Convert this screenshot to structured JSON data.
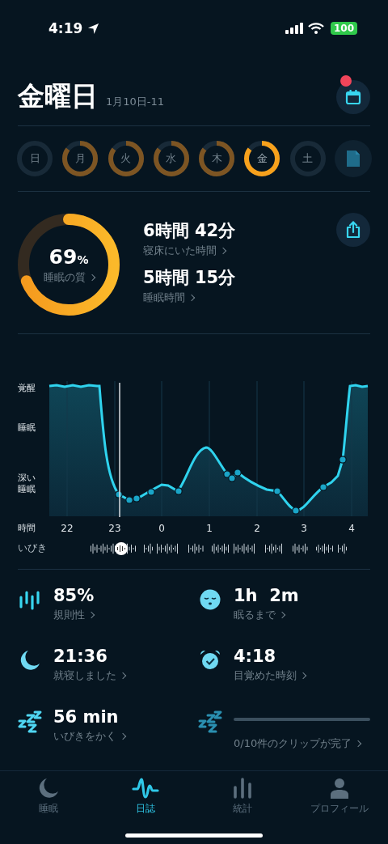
{
  "status_bar": {
    "time": "4:19",
    "battery": "100"
  },
  "header": {
    "title": "金曜日",
    "date_range": "1月10日-11",
    "calendar_badge": true
  },
  "days": [
    {
      "label": "日",
      "recorded": false,
      "selected": false
    },
    {
      "label": "月",
      "recorded": true,
      "selected": false
    },
    {
      "label": "火",
      "recorded": true,
      "selected": false
    },
    {
      "label": "水",
      "recorded": true,
      "selected": false
    },
    {
      "label": "木",
      "recorded": true,
      "selected": false
    },
    {
      "label": "金",
      "recorded": true,
      "selected": true
    },
    {
      "label": "土",
      "recorded": false,
      "selected": false
    }
  ],
  "summary": {
    "quality": "69",
    "quality_unit": "%",
    "quality_label": "睡眠の質",
    "metrics": [
      {
        "value": "6時間 42分",
        "label": "寝床にいた時間"
      },
      {
        "value": "5時間 15分",
        "label": "睡眠時間"
      }
    ]
  },
  "chart": {
    "y_labels": [
      "覚醒",
      "睡眠",
      "深い睡眠"
    ],
    "x_title": "時間",
    "x_labels": [
      "22",
      "23",
      "0",
      "1",
      "2",
      "3",
      "4"
    ],
    "snore_label": "いびき"
  },
  "stats": [
    {
      "kind": "regularity",
      "value": "85%",
      "label": "規則性"
    },
    {
      "kind": "fall_asleep",
      "value": "1h  2m",
      "label": "眠るまで"
    },
    {
      "kind": "bedtime",
      "value": "21:36",
      "label": "就寝しました"
    },
    {
      "kind": "wake",
      "value": "4:18",
      "label": "目覚めた時刻"
    },
    {
      "kind": "snoring",
      "value": "56 min",
      "label": "いびきをかく"
    },
    {
      "kind": "clips",
      "label": "0/10件のクリップが完了"
    }
  ],
  "tabs": [
    {
      "kind": "sleep",
      "label": "睡眠",
      "selected": false
    },
    {
      "kind": "journal",
      "label": "日誌",
      "selected": true
    },
    {
      "kind": "stats",
      "label": "統計",
      "selected": false
    },
    {
      "kind": "profile",
      "label": "プロフィール",
      "selected": false
    }
  ]
}
